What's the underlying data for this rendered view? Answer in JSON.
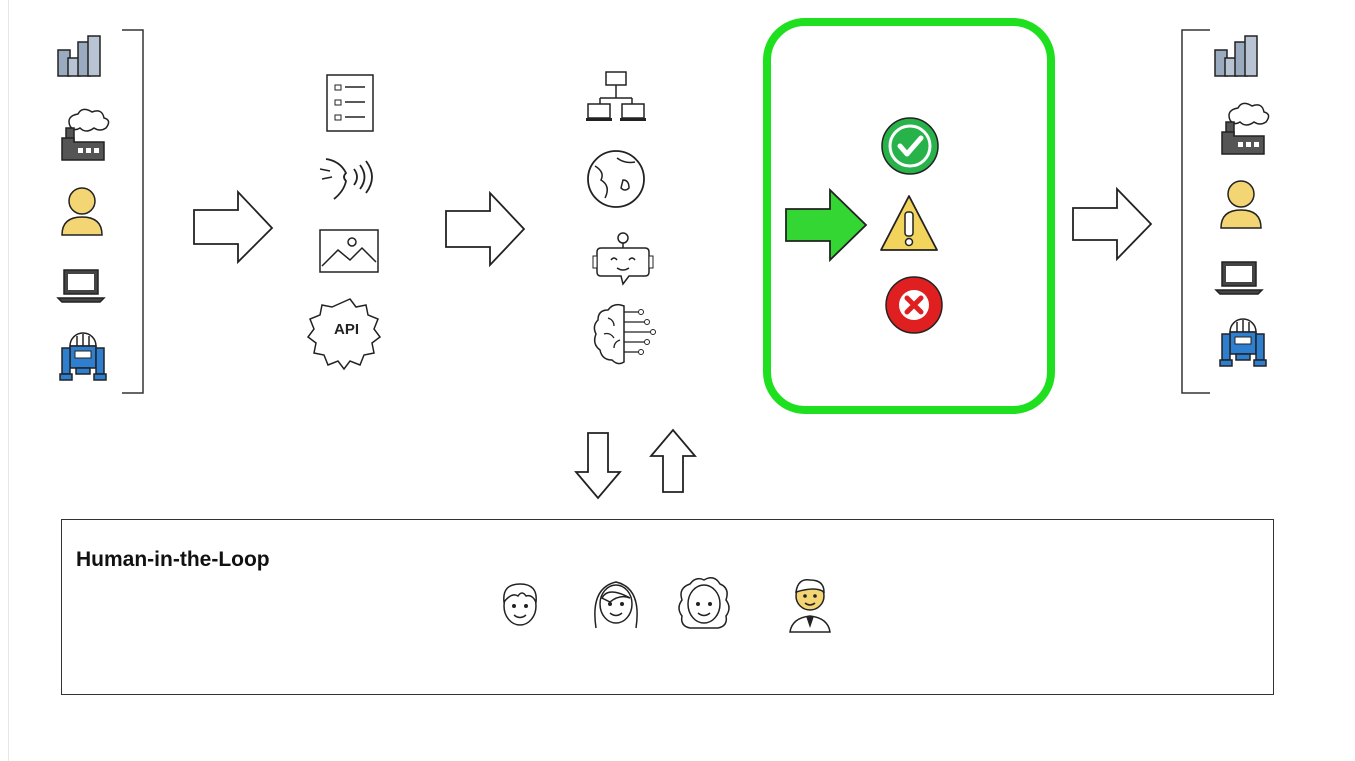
{
  "human_in_the_loop": {
    "title": "Human-in-the-Loop",
    "people": [
      "boy-face-icon",
      "woman-face-icon",
      "curly-woman-face-icon",
      "businessman-icon"
    ]
  },
  "stages": {
    "sources": [
      "city-buildings-icon",
      "factory-icon",
      "person-icon",
      "laptop-icon",
      "robot-icon"
    ],
    "inputs": [
      "document-list-icon",
      "speech-icon",
      "image-icon",
      "api-gear-icon"
    ],
    "processing": [
      "network-icon",
      "globe-icon",
      "chatbot-icon",
      "ai-brain-icon"
    ],
    "validation": [
      "check-icon",
      "warning-icon",
      "error-icon"
    ],
    "destinations": [
      "city-buildings-icon",
      "factory-icon",
      "person-icon",
      "laptop-icon",
      "robot-icon"
    ]
  },
  "colors": {
    "highlight_border": "#1fe01f",
    "highlight_arrow": "#33d633",
    "check": "#27b24a",
    "warning": "#f2d35c",
    "error": "#e02020",
    "person": "#f3d573",
    "robot": "#2f7fd1",
    "buildings": "#9aaabf"
  }
}
